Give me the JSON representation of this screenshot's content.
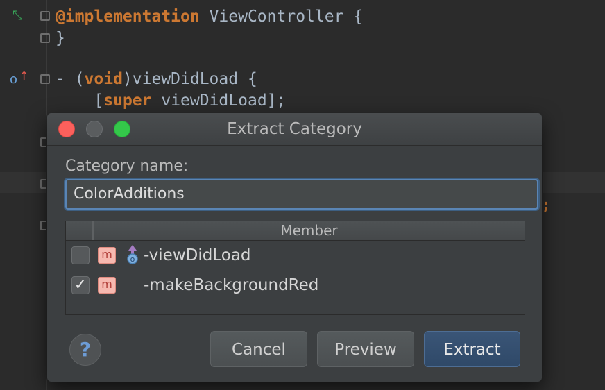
{
  "editor": {
    "line1": {
      "kw": "@implementation",
      "rest": " ViewController {"
    },
    "line2": "}",
    "line3": {
      "prefix": "- (",
      "kw": "void",
      "rest": ")viewDidLoad {"
    },
    "line4": {
      "open": "    [",
      "kw": "super",
      "rest": " viewDidLoad];"
    },
    "stray_semicolon": ";"
  },
  "dialog": {
    "title": "Extract Category",
    "category_label": "Category name:",
    "category_value": "ColorAdditions",
    "table": {
      "column_header": "Member",
      "rows": [
        {
          "badge": "m",
          "name": "-viewDidLoad",
          "checked": false,
          "overrides_icon": true
        },
        {
          "badge": "m",
          "name": "-makeBackgroundRed",
          "checked": true,
          "overrides_icon": false
        }
      ]
    },
    "help_label": "?",
    "buttons": {
      "cancel": "Cancel",
      "preview": "Preview",
      "extract": "Extract"
    },
    "checkmark": "✓"
  },
  "colors": {
    "keyword": "#cc7832",
    "text": "#a9b7c6",
    "focus": "#5a85b5",
    "badge_bg": "#f6b9b0",
    "close": "#fc605c",
    "zoom": "#34c84a"
  }
}
